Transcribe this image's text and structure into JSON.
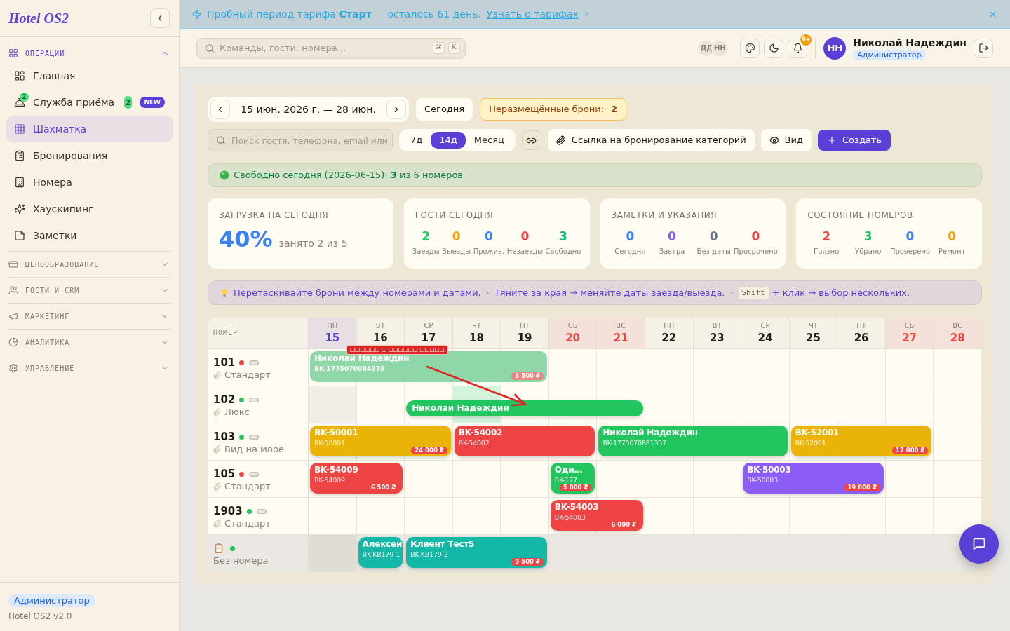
{
  "sidebar": {
    "logo": "Hotel OS2",
    "sections": [
      {
        "label": "ОПЕРАЦИИ",
        "expanded": true,
        "items": [
          {
            "label": "Главная",
            "selected": false
          },
          {
            "label": "Служба приёма",
            "selected": false,
            "icon_badge": "2",
            "count": "2",
            "tag": "NEW"
          },
          {
            "label": "Шахматка",
            "selected": true
          },
          {
            "label": "Бронирования",
            "selected": false
          },
          {
            "label": "Номера",
            "selected": false
          },
          {
            "label": "Хаускипинг",
            "selected": false
          },
          {
            "label": "Заметки",
            "selected": false
          }
        ]
      },
      {
        "label": "ЦЕНООБРАЗОВАНИЕ",
        "expanded": false
      },
      {
        "label": "ГОСТИ И CRM",
        "expanded": false
      },
      {
        "label": "МАРКЕТИНГ",
        "expanded": false
      },
      {
        "label": "АНАЛИТИКА",
        "expanded": false
      },
      {
        "label": "УПРАВЛЕНИЕ",
        "expanded": false
      }
    ],
    "role": "Администратор",
    "version": "Hotel OS2 v2.0"
  },
  "banner": {
    "text": "Пробный период тарифа **Старт** — осталось 61 день.",
    "link": "Узнать о тарифах"
  },
  "header": {
    "search": {
      "placeholder": "Команды, гости, номера...",
      "shortcut": [
        "⌘",
        "K"
      ]
    },
    "online_users": [
      "ДД",
      "НН"
    ],
    "notifications": "9+",
    "user": {
      "initials": "НН",
      "name": "Николай Надеждин",
      "role": "Администратор"
    }
  },
  "toolbar": {
    "period": "15 июн. 2026 г. — 28 июн.",
    "today": "Сегодня",
    "unplaced": {
      "label": "Неразмещённые брони:",
      "count": "2"
    },
    "search": {
      "placeholder": "Поиск гостя, телефона, email или"
    },
    "ranges": [
      {
        "label": "7д",
        "selected": false
      },
      {
        "label": "14д",
        "selected": true
      },
      {
        "label": "Месяц",
        "selected": false
      }
    ],
    "booking_link": "Ссылка на бронирование категорий",
    "view": "Вид",
    "create": "Создать"
  },
  "availability": "Свободно сегодня (2026-06-15): **3** из 6 номеров",
  "stats": [
    {
      "kind": "load",
      "title": "ЗАГРУЗКА НА СЕГОДНЯ",
      "value": "40%",
      "caption": "занято 2 из 5"
    },
    {
      "kind": "counts",
      "title": "ГОСТИ СЕГОДНЯ",
      "items": [
        {
          "value": "2",
          "label": "Заезды",
          "color": "#22c55e"
        },
        {
          "value": "0",
          "label": "Выезды",
          "color": "#f59e0b"
        },
        {
          "value": "0",
          "label": "Прожив.",
          "color": "#3b82f6"
        },
        {
          "value": "0",
          "label": "Незаезды",
          "color": "#ef4444"
        },
        {
          "value": "3",
          "label": "Свободно",
          "color": "#10b981"
        }
      ]
    },
    {
      "kind": "counts",
      "title": "ЗАМЕТКИ И УКАЗАНИЯ",
      "items": [
        {
          "value": "0",
          "label": "Сегодня",
          "color": "#3b82f6"
        },
        {
          "value": "0",
          "label": "Завтра",
          "color": "#8b5cf6"
        },
        {
          "value": "0",
          "label": "Без даты",
          "color": "#64748b"
        },
        {
          "value": "0",
          "label": "Просрочено",
          "color": "#ef4444"
        }
      ]
    },
    {
      "kind": "counts",
      "title": "СОСТОЯНИЕ НОМЕРОВ",
      "items": [
        {
          "value": "2",
          "label": "Грязно",
          "color": "#ef4444"
        },
        {
          "value": "3",
          "label": "Убрано",
          "color": "#22c55e"
        },
        {
          "value": "0",
          "label": "Проверено",
          "color": "#3b82f6"
        },
        {
          "value": "0",
          "label": "Ремонт",
          "color": "#f59e0b"
        }
      ]
    }
  ],
  "hint": {
    "steps": [
      "Перетаскивайте брони между номерами и датами.",
      "Тяните за края → меняйте даты заезда/выезда."
    ],
    "key": "Shift",
    "key_action": "+ клик → выбор нескольких."
  },
  "calendar": {
    "room_heading": "НОМЕР",
    "days": [
      {
        "weekday": "ПН",
        "date": "15",
        "today": true,
        "weekend": false
      },
      {
        "weekday": "ВТ",
        "date": "16",
        "today": false,
        "weekend": false
      },
      {
        "weekday": "СР",
        "date": "17",
        "today": false,
        "weekend": false
      },
      {
        "weekday": "ЧТ",
        "date": "18",
        "today": false,
        "weekend": false
      },
      {
        "weekday": "ПТ",
        "date": "19",
        "today": false,
        "weekend": false
      },
      {
        "weekday": "СБ",
        "date": "20",
        "today": false,
        "weekend": true
      },
      {
        "weekday": "ВС",
        "date": "21",
        "today": false,
        "weekend": true
      },
      {
        "weekday": "ПН",
        "date": "22",
        "today": false,
        "weekend": false
      },
      {
        "weekday": "ВТ",
        "date": "23",
        "today": false,
        "weekend": false
      },
      {
        "weekday": "СР",
        "date": "24",
        "today": false,
        "weekend": false
      },
      {
        "weekday": "ЧТ",
        "date": "25",
        "today": false,
        "weekend": false
      },
      {
        "weekday": "ПТ",
        "date": "26",
        "today": false,
        "weekend": false
      },
      {
        "weekday": "СБ",
        "date": "27",
        "today": false,
        "weekend": true
      },
      {
        "weekday": "ВС",
        "date": "28",
        "today": false,
        "weekend": true
      }
    ],
    "rows": [
      {
        "kind": "room",
        "number": "101",
        "color": "#ef4444",
        "category": "Стандарт",
        "slots": [
          {
            "kind": "start",
            "booking": {
              "kind": "dragging",
              "title": "Николай Надеждин",
              "code": "BK-1775070984878",
              "price": "3 500 ₽",
              "color": "#8fd6a8",
              "drag_label": "□□□□□□ □ □□□□□□ □□□□□"
            }
          },
          {
            "kind": "continues"
          },
          {
            "kind": "continues"
          },
          {
            "kind": "continues"
          },
          {
            "kind": "continues"
          },
          {
            "kind": "free"
          },
          {
            "kind": "free"
          },
          {
            "kind": "free"
          },
          {
            "kind": "free"
          },
          {
            "kind": "free"
          },
          {
            "kind": "free"
          },
          {
            "kind": "free"
          },
          {
            "kind": "free"
          },
          {
            "kind": "free"
          }
        ]
      },
      {
        "kind": "room",
        "number": "102",
        "color": "#22c55e",
        "category": "Люкс",
        "slots": [
          {
            "kind": "free",
            "color": "#f2eee5"
          },
          {
            "kind": "free"
          },
          {
            "kind": "start",
            "booking": {
              "kind": "drop_preview",
              "title": "Николай Надеждин",
              "color": "#22c55e"
            }
          },
          {
            "kind": "continues",
            "color": "#d3f3da"
          },
          {
            "kind": "continues"
          },
          {
            "kind": "continues"
          },
          {
            "kind": "continues"
          },
          {
            "kind": "free"
          },
          {
            "kind": "free"
          },
          {
            "kind": "free"
          },
          {
            "kind": "free"
          },
          {
            "kind": "free"
          },
          {
            "kind": "free"
          },
          {
            "kind": "free"
          }
        ]
      },
      {
        "kind": "room",
        "number": "103",
        "color": "#22c55e",
        "category": "Вид на море",
        "slots": [
          {
            "kind": "start",
            "booking": {
              "kind": "booking",
              "title": "BK-50001",
              "code": "BK-50001",
              "price": "24 000 ₽",
              "color": "#eab308"
            }
          },
          {
            "kind": "continues"
          },
          {
            "kind": "continues"
          },
          {
            "kind": "start",
            "booking": {
              "kind": "booking",
              "title": "BK-54002",
              "code": "BK-54002",
              "color": "#ef4444"
            }
          },
          {
            "kind": "continues"
          },
          {
            "kind": "continues"
          },
          {
            "kind": "start",
            "booking": {
              "kind": "booking",
              "title": "Николай Надеждин",
              "code": "BK-1775070881357",
              "color": "#22c55e"
            }
          },
          {
            "kind": "continues"
          },
          {
            "kind": "continues"
          },
          {
            "kind": "continues"
          },
          {
            "kind": "start",
            "booking": {
              "kind": "booking",
              "title": "BK-52001",
              "code": "BK-52001",
              "price": "12 000 ₽",
              "color": "#eab308"
            }
          },
          {
            "kind": "continues"
          },
          {
            "kind": "continues"
          },
          {
            "kind": "free"
          }
        ]
      },
      {
        "kind": "room",
        "number": "105",
        "color": "#ef4444",
        "category": "Стандарт",
        "slots": [
          {
            "kind": "start",
            "booking": {
              "kind": "booking",
              "title": "BK-54009",
              "code": "BK-54009",
              "price": "6 500 ₽",
              "color": "#ef4444"
            }
          },
          {
            "kind": "continues"
          },
          {
            "kind": "free"
          },
          {
            "kind": "free"
          },
          {
            "kind": "free"
          },
          {
            "kind": "start",
            "booking": {
              "kind": "booking",
              "title": "Оди…",
              "code": "BK-177",
              "price": "5 000 ₽",
              "color": "#22c55e"
            }
          },
          {
            "kind": "free"
          },
          {
            "kind": "free"
          },
          {
            "kind": "free"
          },
          {
            "kind": "start",
            "booking": {
              "kind": "booking",
              "title": "BK-50003",
              "code": "BK-50003",
              "price": "19 800 ₽",
              "color": "#8b5cf6"
            }
          },
          {
            "kind": "continues"
          },
          {
            "kind": "continues"
          },
          {
            "kind": "free"
          },
          {
            "kind": "free"
          }
        ]
      },
      {
        "kind": "room",
        "number": "1903",
        "color": "#22c55e",
        "category": "Стандарт",
        "slots": [
          {
            "kind": "free"
          },
          {
            "kind": "free"
          },
          {
            "kind": "free"
          },
          {
            "kind": "free"
          },
          {
            "kind": "free"
          },
          {
            "kind": "start",
            "booking": {
              "kind": "booking",
              "title": "BK-54003",
              "code": "BK-54003",
              "price": "6 000 ₽",
              "color": "#ef4444"
            }
          },
          {
            "kind": "continues"
          },
          {
            "kind": "free"
          },
          {
            "kind": "free"
          },
          {
            "kind": "free"
          },
          {
            "kind": "free"
          },
          {
            "kind": "free"
          },
          {
            "kind": "free"
          },
          {
            "kind": "free"
          }
        ]
      },
      {
        "kind": "unassigned",
        "label": "Без номера",
        "color": "#22c55e",
        "slots": [
          {
            "kind": "free",
            "color": "#e0ddd6"
          },
          {
            "kind": "start",
            "booking": {
              "kind": "booking",
              "title": "Алексей",
              "code": "BK-KB179-1",
              "color": "#14b8a6"
            }
          },
          {
            "kind": "start",
            "booking": {
              "kind": "booking",
              "title": "Клиент Тест5",
              "code": "BK-KB179-2",
              "price": "9 500 ₽",
              "color": "#14b8a6"
            }
          },
          {
            "kind": "continues"
          },
          {
            "kind": "continues"
          },
          {
            "kind": "free"
          },
          {
            "kind": "free"
          },
          {
            "kind": "free"
          },
          {
            "kind": "free"
          },
          {
            "kind": "free"
          },
          {
            "kind": "free"
          },
          {
            "kind": "free"
          },
          {
            "kind": "free"
          },
          {
            "kind": "free"
          }
        ]
      }
    ]
  }
}
